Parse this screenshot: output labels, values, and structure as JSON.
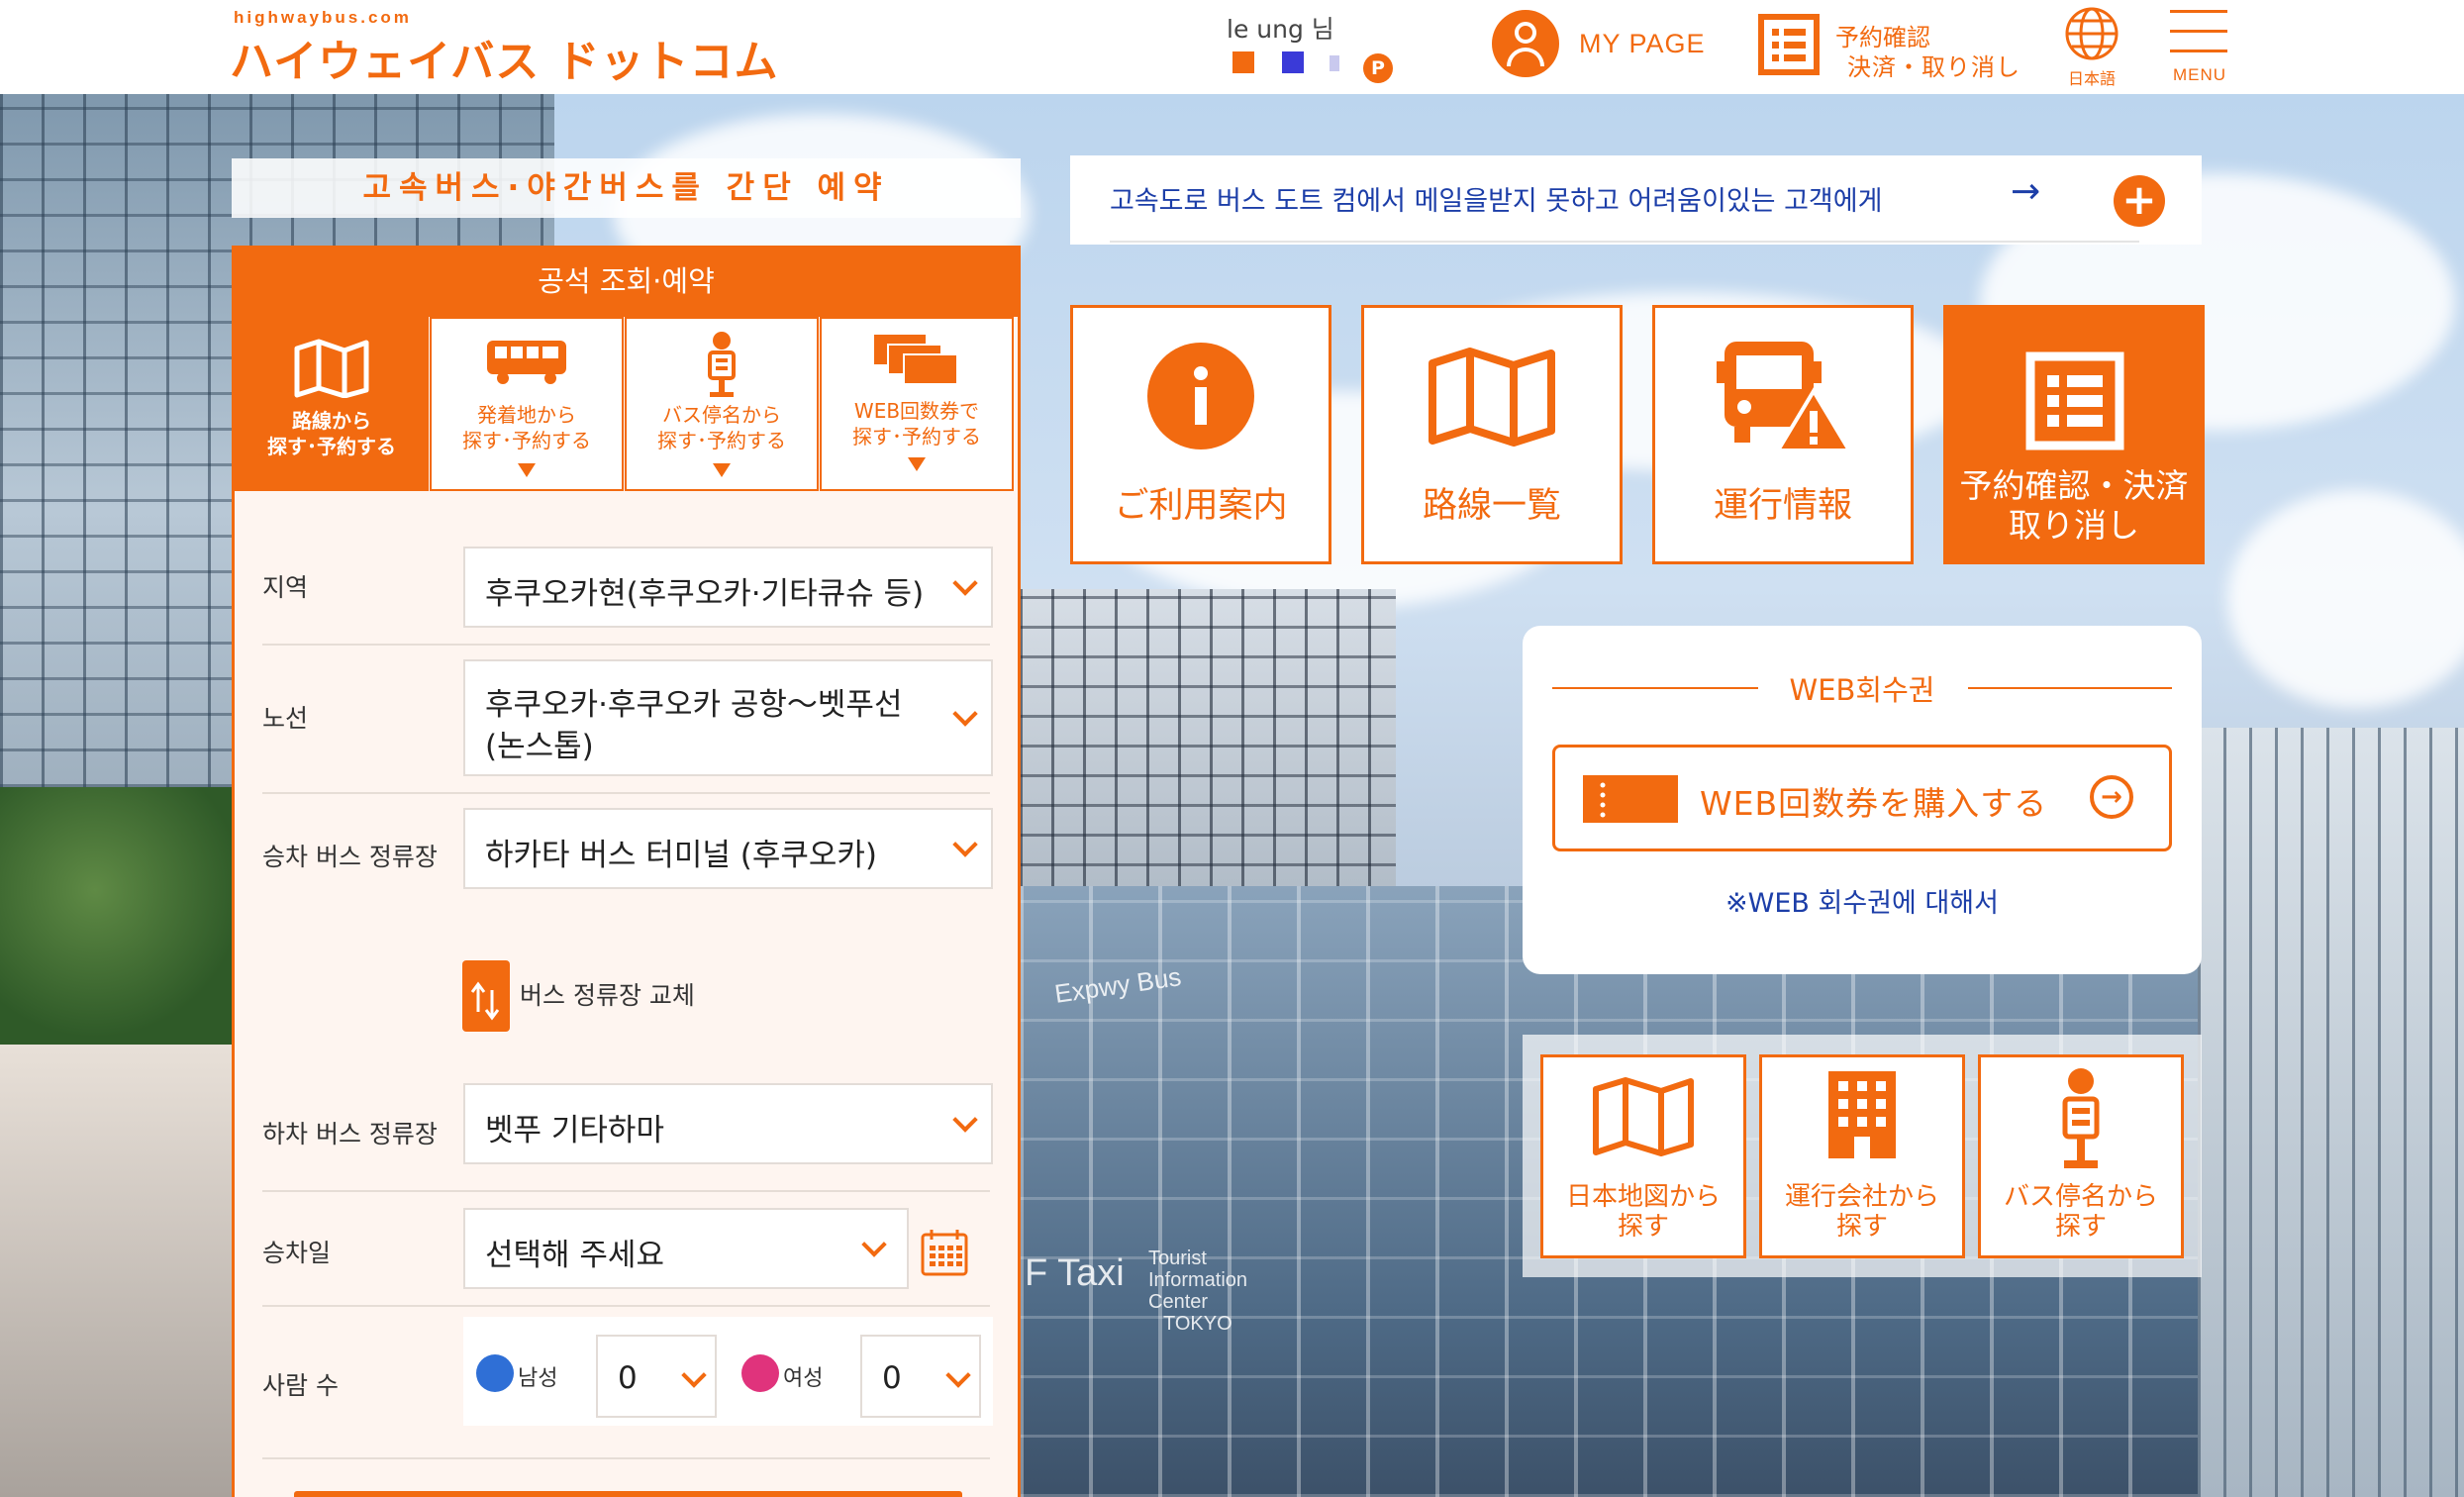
{
  "header": {
    "logo_small": "highwaybus.com",
    "logo_big": "ハイウェイバス ドットコム",
    "user_name": "le   ung 님",
    "user_points_badge": "P",
    "mypage_label": "MY PAGE",
    "confirm_line1": "予約確認",
    "confirm_line2": "決済・取り消し",
    "lang_label": "日本語",
    "menu_label": "MENU"
  },
  "banner_text": "고속버스·야간버스를 간단 예약",
  "panel": {
    "title": "공석 조회·예약",
    "tabs": [
      {
        "line1": "路線から",
        "line2": "探す･予約する",
        "icon": "map-icon"
      },
      {
        "line1": "発着地から",
        "line2": "探す･予約する",
        "icon": "bus-icon"
      },
      {
        "line1": "バス停名から",
        "line2": "探す･予約する",
        "icon": "bus-stop-icon"
      },
      {
        "line1": "WEB回数券で",
        "line2": "探す･予約する",
        "icon": "ticket-icon"
      }
    ],
    "region_label": "지역",
    "region_value": "후쿠오카현(후쿠오카·기타큐슈 등)",
    "route_label": "노선",
    "route_value_line1": "후쿠오카·후쿠오카 공항～벳푸선",
    "route_value_line2": "(논스톱)",
    "board_label": "승차 버스 정류장",
    "board_value": "하카타 버스 터미널 (후쿠오카)",
    "swap_label": "버스 정류장 교체",
    "alight_label": "하차 버스 정류장",
    "alight_value": "벳푸 기타하마",
    "date_label": "승차일",
    "date_value": "선택해 주세요",
    "people_label": "사람 수",
    "male_label": "남성",
    "male_value": "0",
    "female_label": "여성",
    "female_value": "0"
  },
  "notice": {
    "text": "고속도로 버스 도트 컴에서 메일을받지 못하고 어려움이있는 고객에게",
    "arrow": "→",
    "plus": "+"
  },
  "cards": [
    {
      "label": "ご利用案内",
      "icon": "info-icon"
    },
    {
      "label": "路線一覧",
      "icon": "map-icon"
    },
    {
      "label": "運行情報",
      "icon": "bus-warning-icon"
    },
    {
      "label_line1": "予約確認・決済",
      "label_line2": "取り消し",
      "icon": "list-icon"
    }
  ],
  "web_ticket": {
    "title": "WEB회수권",
    "button_label": "WEB回数券を購入する",
    "link": "※WEB 회수권에 대해서"
  },
  "bottom_cards": [
    {
      "line1": "日本地図から",
      "line2": "探す",
      "icon": "map-icon"
    },
    {
      "line1": "運行会社から",
      "line2": "探す",
      "icon": "building-icon"
    },
    {
      "line1": "バス停名から",
      "line2": "探す",
      "icon": "bus-stop-icon"
    }
  ],
  "background_text": {
    "sign1": "Expwy Bus",
    "sign2": "F Taxi",
    "sign3_line1": "Tourist",
    "sign3_line2": "Information",
    "sign3_line3": "Center",
    "sign3_line4": "TOKYO"
  },
  "colors": {
    "accent": "#f26a10",
    "link": "#1c3ea8",
    "panel_bg": "#fef5f0"
  }
}
